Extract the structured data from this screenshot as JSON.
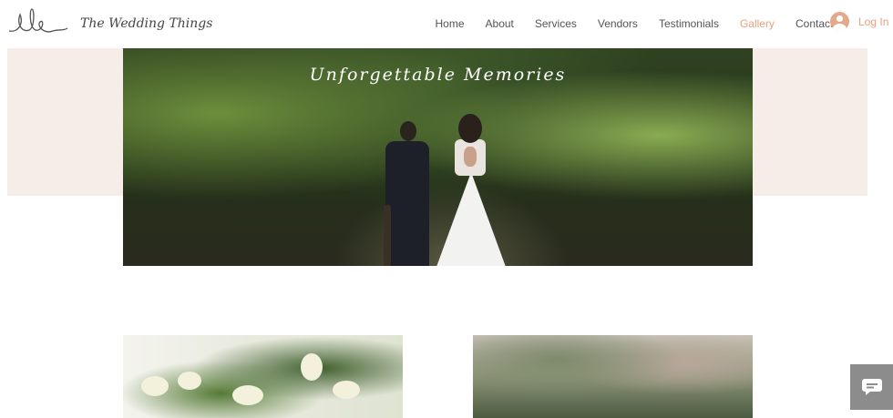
{
  "header": {
    "brand": "The Wedding Things",
    "nav": [
      "Home",
      "About",
      "Services",
      "Vendors",
      "Testimonials",
      "Gallery",
      "Contact"
    ],
    "active_nav": "Gallery",
    "login_label": "Log In"
  },
  "hero": {
    "title": "Unforgettable Memories"
  },
  "icons": {
    "logo": "ele-script-logo",
    "avatar": "user-avatar-icon",
    "chat": "chat-bubble-icon"
  },
  "colors": {
    "accent": "#e8a07e",
    "band": "#f7ede8",
    "chat_bg": "#8c8c8c"
  }
}
